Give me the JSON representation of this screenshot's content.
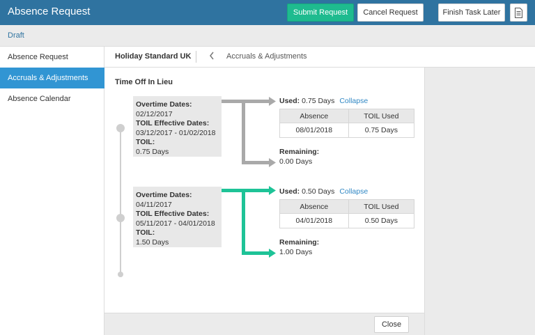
{
  "header": {
    "title": "Absence Request",
    "submit_label": "Submit Request",
    "cancel_label": "Cancel Request",
    "finish_later_label": "Finish Task Later",
    "notes_icon": "notes-icon"
  },
  "status": {
    "label": "Draft"
  },
  "sidebar": {
    "items": [
      {
        "label": "Absence Request",
        "active": false
      },
      {
        "label": "Accruals & Adjustments",
        "active": true
      },
      {
        "label": "Absence Calendar",
        "active": false
      }
    ]
  },
  "tabs": {
    "title": "Holiday Standard UK",
    "back_icon": "chevron-left-icon",
    "current": "Accruals & Adjustments"
  },
  "main": {
    "section_title": "Time Off In Lieu",
    "entries": [
      {
        "overtime_label": "Overtime Dates:",
        "overtime_value": "02/12/2017",
        "effective_label": "TOIL Effective Dates:",
        "effective_value": "03/12/2017 - 01/02/2018",
        "toil_label": "TOIL:",
        "toil_value": "0.75 Days",
        "used_label": "Used:",
        "used_value": "0.75 Days",
        "collapse_label": "Collapse",
        "table_headers": [
          "Absence",
          "TOIL Used"
        ],
        "table_rows": [
          [
            "08/01/2018",
            "0.75 Days"
          ]
        ],
        "remaining_label": "Remaining:",
        "remaining_value": "0.00 Days",
        "arrow_color": "#a9a9a9"
      },
      {
        "overtime_label": "Overtime Dates:",
        "overtime_value": "04/11/2017",
        "effective_label": "TOIL Effective Dates:",
        "effective_value": "05/11/2017 - 04/01/2018",
        "toil_label": "TOIL:",
        "toil_value": "1.50 Days",
        "used_label": "Used:",
        "used_value": "0.50 Days",
        "collapse_label": "Collapse",
        "table_headers": [
          "Absence",
          "TOIL Used"
        ],
        "table_rows": [
          [
            "04/01/2018",
            "0.50 Days"
          ]
        ],
        "remaining_label": "Remaining:",
        "remaining_value": "1.00 Days",
        "arrow_color": "#1ec397"
      }
    ]
  },
  "footer": {
    "close_label": "Close"
  },
  "colors": {
    "header_bg": "#2f73a0",
    "submit_bg": "#1ebb8f",
    "sidebar_active": "#3195d3",
    "link": "#2f87c4"
  }
}
